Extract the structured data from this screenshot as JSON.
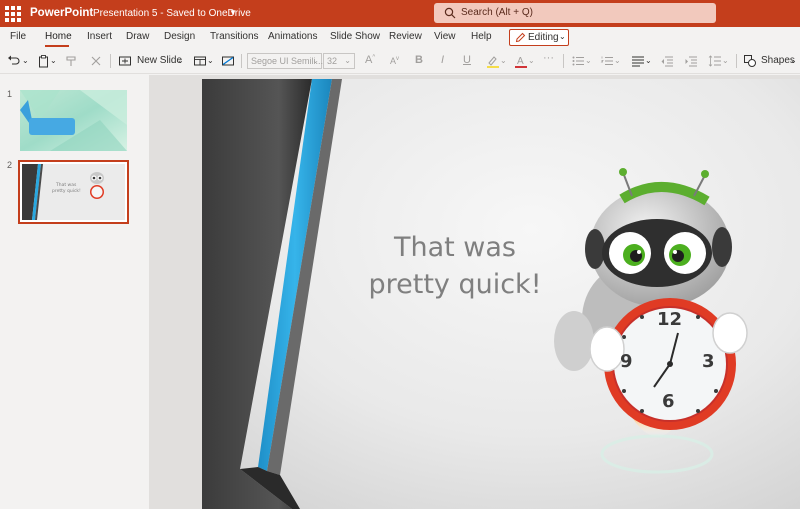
{
  "titlebar": {
    "app_name": "PowerPoint",
    "doc_name": "Presentation 5  -  Saved to OneDrive",
    "search_placeholder": "Search (Alt + Q)"
  },
  "tabs": [
    {
      "label": "File"
    },
    {
      "label": "Home"
    },
    {
      "label": "Insert"
    },
    {
      "label": "Draw"
    },
    {
      "label": "Design"
    },
    {
      "label": "Transitions"
    },
    {
      "label": "Animations"
    },
    {
      "label": "Slide Show"
    },
    {
      "label": "Review"
    },
    {
      "label": "View"
    },
    {
      "label": "Help"
    }
  ],
  "active_tab": "Home",
  "mode": {
    "label": "Editing"
  },
  "toolbar": {
    "new_slide_label": "New Slide",
    "font_name": "Segoe UI Semili...",
    "font_size": "32",
    "shapes_label": "Shapes"
  },
  "thumbnails": [
    {
      "number": "1"
    },
    {
      "number": "2",
      "title": "That was pretty quick!"
    }
  ],
  "slide": {
    "title_line1": "That was",
    "title_line2": "pretty quick!"
  },
  "clock_numbers": {
    "n12": "12",
    "n3": "3",
    "n6": "6",
    "n9": "9"
  },
  "colors": {
    "brand": "#c43e1c",
    "slide_accent": "#29a8e0",
    "title_text": "#7f7f7f"
  }
}
